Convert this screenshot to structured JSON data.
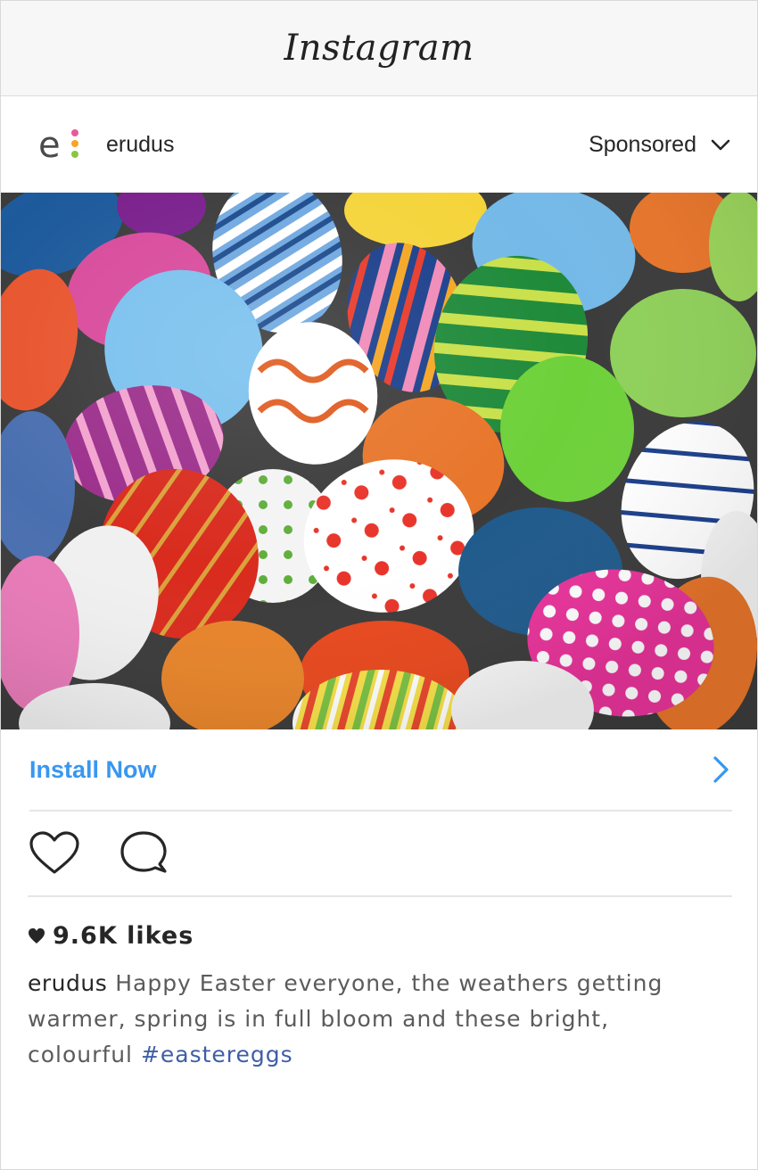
{
  "app": {
    "title": "Instagram"
  },
  "post": {
    "username": "erudus",
    "sponsored_label": "Sponsored",
    "cta_label": "Install Now",
    "likes": "9.6K likes",
    "caption_user": "erudus",
    "caption_text": "Happy Easter everyone, the weathers getting warmer, spring is in full bloom and these bright, colourful",
    "hashtag": "#eastereggs"
  },
  "icons": {
    "avatar": "erudus-logo-icon",
    "menu": "chevron-down-icon",
    "cta": "chevron-right-icon",
    "like": "heart-icon",
    "comment": "comment-icon",
    "likes_heart": "heart-filled-icon"
  },
  "colors": {
    "cta": "#3897f0",
    "hashtag": "#3f5ea6",
    "text": "#262626"
  }
}
